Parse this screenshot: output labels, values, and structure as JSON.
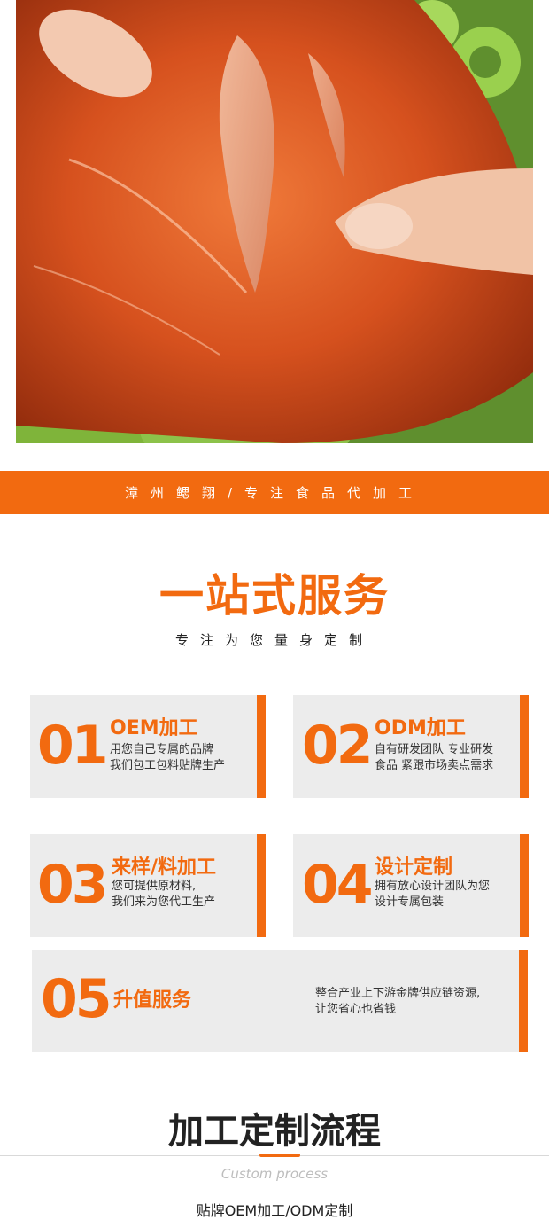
{
  "hero": {
    "image": "chicken-wing-food-photo"
  },
  "banner": {
    "text": "漳州鳃翔/专注食品代加工"
  },
  "service": {
    "title": "一站式服务",
    "subtitle": "专注为您量身定制"
  },
  "cards": [
    {
      "num": "01",
      "title": "OEM加工",
      "desc1": "用您自己专属的品牌",
      "desc2": "我们包工包料贴牌生产"
    },
    {
      "num": "02",
      "title": "ODM加工",
      "desc1": "自有研发团队 专业研发",
      "desc2": "食品 紧跟市场卖点需求"
    },
    {
      "num": "03",
      "title": "来样/料加工",
      "desc1": "您可提供原材料,",
      "desc2": "我们来为您代工生产"
    },
    {
      "num": "04",
      "title": "设计定制",
      "desc1": "拥有放心设计团队为您",
      "desc2": "设计专属包装"
    },
    {
      "num": "05",
      "title": "升值服务",
      "desc1": "整合产业上下游金牌供应链资源,",
      "desc2": "让您省心也省钱"
    }
  ],
  "process": {
    "title": "加工定制流程",
    "subtitle_en": "Custom process",
    "caption": "贴牌OEM加工/ODM定制"
  },
  "colors": {
    "accent": "#f26a10",
    "card_bg": "#ececec"
  }
}
